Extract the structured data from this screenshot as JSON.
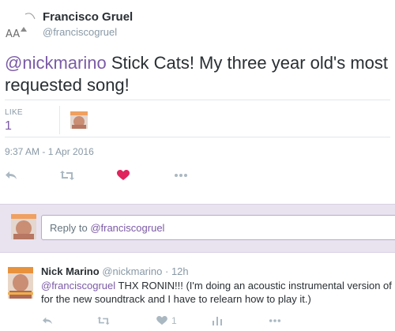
{
  "tweet": {
    "author_name": "Francisco Gruel",
    "author_handle": "@franciscogruel",
    "mention": "@nickmarino",
    "text": " Stick Cats! My three year old's most requested song!",
    "likes_label": "LIKE",
    "likes_count": "1",
    "timestamp": "9:37 AM - 1 Apr 2016"
  },
  "reply_box": {
    "prefix": "Reply to ",
    "mention": "@franciscogruel"
  },
  "reply_tweet": {
    "author_name": "Nick Marino",
    "author_handle": "@nickmarino",
    "separator": " · ",
    "time": "12h",
    "mention": "@franciscogruel",
    "text_line1": " THX RONIN!!! (I'm doing an acoustic instrumental version of it",
    "text_line2": "for the new soundtrack and I have to relearn how to play it.)",
    "like_count": "1"
  },
  "colors": {
    "accent": "#7b5aa6",
    "heart": "#e0245e",
    "reply_bg": "#e8e3ef",
    "muted": "#8899a6",
    "icon": "#aab8c2"
  },
  "icons": {
    "reply": "reply-arrow-icon",
    "retweet": "retweet-icon",
    "like": "heart-icon",
    "more": "more-dots-icon",
    "stats": "analytics-icon"
  }
}
